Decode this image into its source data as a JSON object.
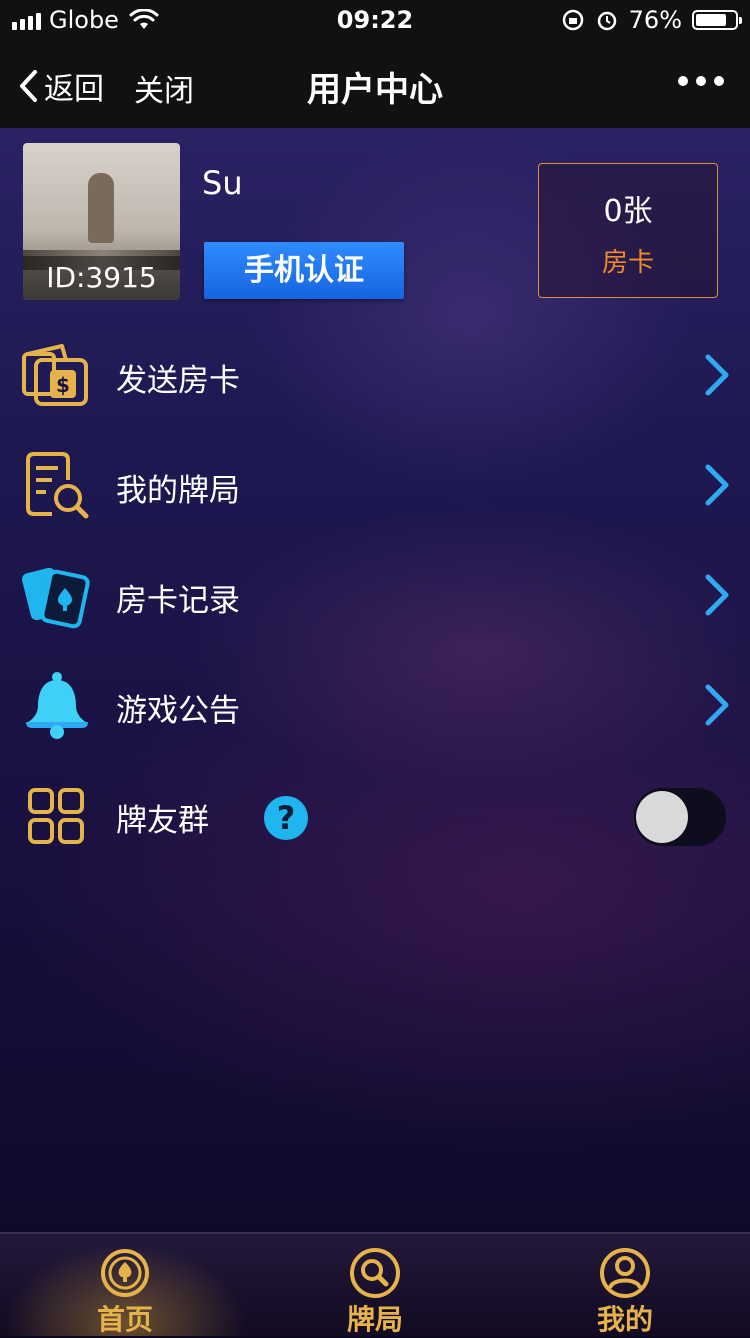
{
  "status_bar": {
    "carrier": "Globe",
    "time": "09:22",
    "battery": "76%"
  },
  "nav": {
    "back_label": "返回",
    "close_label": "关闭",
    "title": "用户中心"
  },
  "profile": {
    "name": "Su",
    "id_text": "ID:3915",
    "verify_button": "手机认证",
    "card_count": "0张",
    "card_label": "房卡"
  },
  "menu": [
    {
      "label": "发送房卡",
      "icon": "send-card-icon"
    },
    {
      "label": "我的牌局",
      "icon": "game-record-icon"
    },
    {
      "label": "房卡记录",
      "icon": "cards-icon"
    },
    {
      "label": "游戏公告",
      "icon": "bell-icon"
    }
  ],
  "friend_group": {
    "label": "牌友群",
    "help": "?",
    "toggle_on": false
  },
  "tabs": [
    {
      "label": "首页",
      "icon": "spade-coin-icon",
      "active": true
    },
    {
      "label": "牌局",
      "icon": "magnifier-icon",
      "active": false
    },
    {
      "label": "我的",
      "icon": "user-icon",
      "active": false
    }
  ],
  "colors": {
    "accent_gold": "#e6b24a",
    "accent_blue": "#1fb5ee",
    "card_label": "#f08a2a",
    "verify_blue": "#1664e0"
  }
}
